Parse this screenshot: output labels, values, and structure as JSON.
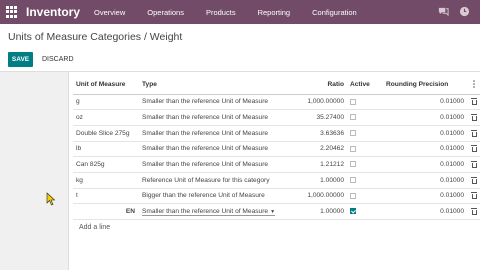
{
  "navbar": {
    "app_name": "Inventory",
    "menu": [
      "Overview",
      "Operations",
      "Products",
      "Reporting",
      "Configuration"
    ],
    "icons": [
      "apps-icon",
      "chat-icon",
      "clock-icon"
    ]
  },
  "control": {
    "breadcrumb": "Units of Measure Categories / Weight",
    "save_label": "SAVE",
    "discard_label": "DISCARD"
  },
  "table": {
    "headers": {
      "uom": "Unit of Measure",
      "type": "Type",
      "ratio": "Ratio",
      "active": "Active",
      "rounding": "Rounding Precision"
    },
    "rows": [
      {
        "uom": "g",
        "type": "Smaller than the reference Unit of Measure",
        "ratio": "1,000.00000",
        "active": true,
        "rounding": "0.01000"
      },
      {
        "uom": "oz",
        "type": "Smaller than the reference Unit of Measure",
        "ratio": "35.27400",
        "active": true,
        "rounding": "0.01000"
      },
      {
        "uom": "Double Slice 275g",
        "type": "Smaller than the reference Unit of Measure",
        "ratio": "3.63636",
        "active": true,
        "rounding": "0.01000"
      },
      {
        "uom": "lb",
        "type": "Smaller than the reference Unit of Measure",
        "ratio": "2.20462",
        "active": true,
        "rounding": "0.01000"
      },
      {
        "uom": "Can 825g",
        "type": "Smaller than the reference Unit of Measure",
        "ratio": "1.21212",
        "active": true,
        "rounding": "0.01000"
      },
      {
        "uom": "kg",
        "type": "Reference Unit of Measure for this category",
        "ratio": "1.00000",
        "active": true,
        "rounding": "0.01000"
      },
      {
        "uom": "t",
        "type": "Bigger than the reference Unit of Measure",
        "ratio": "1,000.00000",
        "active": true,
        "rounding": "0.01000"
      },
      {
        "uom": "EN",
        "type": "Smaller than the reference Unit of Measure",
        "ratio": "1.00000",
        "active": true,
        "rounding": "0.01000"
      }
    ],
    "add_line": "Add a line"
  }
}
